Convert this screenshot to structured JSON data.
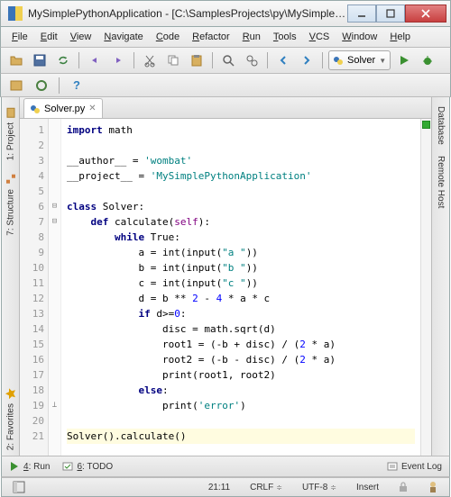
{
  "window": {
    "title": "MySimplePythonApplication - [C:\\SamplesProjects\\py\\MySimpleP..."
  },
  "menu": [
    "File",
    "Edit",
    "View",
    "Navigate",
    "Code",
    "Refactor",
    "Run",
    "Tools",
    "VCS",
    "Window",
    "Help"
  ],
  "run_config": {
    "label": "Solver"
  },
  "tab": {
    "filename": "Solver.py"
  },
  "left_tabs": {
    "project": "1: Project",
    "structure": "7: Structure",
    "favorites": "2: Favorites"
  },
  "right_tabs": {
    "database": "Database",
    "remote": "Remote Host"
  },
  "code_lines": [
    {
      "n": 1,
      "fold": "",
      "html": "<span class='kw'>import</span> math"
    },
    {
      "n": 2,
      "fold": "",
      "html": ""
    },
    {
      "n": 3,
      "fold": "",
      "html": "__author__ = <span class='str'>'wombat'</span>"
    },
    {
      "n": 4,
      "fold": "",
      "html": "__project__ = <span class='str'>'MySimplePythonApplication'</span>"
    },
    {
      "n": 5,
      "fold": "",
      "html": ""
    },
    {
      "n": 6,
      "fold": "⊟",
      "html": "<span class='kw'>class</span> Solver:"
    },
    {
      "n": 7,
      "fold": "⊟",
      "html": "    <span class='kw'>def</span> <span class='fn'>calculate</span>(<span class='selfkw'>self</span>):"
    },
    {
      "n": 8,
      "fold": "",
      "html": "        <span class='kw'>while</span> True:"
    },
    {
      "n": 9,
      "fold": "",
      "html": "            a = int(input(<span class='str'>\"a \"</span>))"
    },
    {
      "n": 10,
      "fold": "",
      "html": "            b = int(input(<span class='str'>\"b \"</span>))"
    },
    {
      "n": 11,
      "fold": "",
      "html": "            c = int(input(<span class='str'>\"c \"</span>))"
    },
    {
      "n": 12,
      "fold": "",
      "html": "            d = b ** <span class='num'>2</span> - <span class='num'>4</span> * a * c"
    },
    {
      "n": 13,
      "fold": "",
      "html": "            <span class='kw'>if</span> d&gt;=<span class='num'>0</span>:"
    },
    {
      "n": 14,
      "fold": "",
      "html": "                disc = math.sqrt(d)"
    },
    {
      "n": 15,
      "fold": "",
      "html": "                root1 = (-b + disc) / (<span class='num'>2</span> * a)"
    },
    {
      "n": 16,
      "fold": "",
      "html": "                root2 = (-b - disc) / (<span class='num'>2</span> * a)"
    },
    {
      "n": 17,
      "fold": "",
      "html": "                print(root1, root2)"
    },
    {
      "n": 18,
      "fold": "",
      "html": "            <span class='kw'>else</span>:"
    },
    {
      "n": 19,
      "fold": "⊥",
      "html": "                print(<span class='str'>'error'</span>)"
    },
    {
      "n": 20,
      "fold": "",
      "html": ""
    },
    {
      "n": 21,
      "fold": "",
      "html": "Solver().calculate()",
      "hl": true
    }
  ],
  "tool_items": {
    "run": "4: Run",
    "todo": "6: TODO",
    "eventlog": "Event Log"
  },
  "status": {
    "pos": "21:11",
    "eol": "CRLF",
    "enc": "UTF-8",
    "mode": "Insert"
  }
}
